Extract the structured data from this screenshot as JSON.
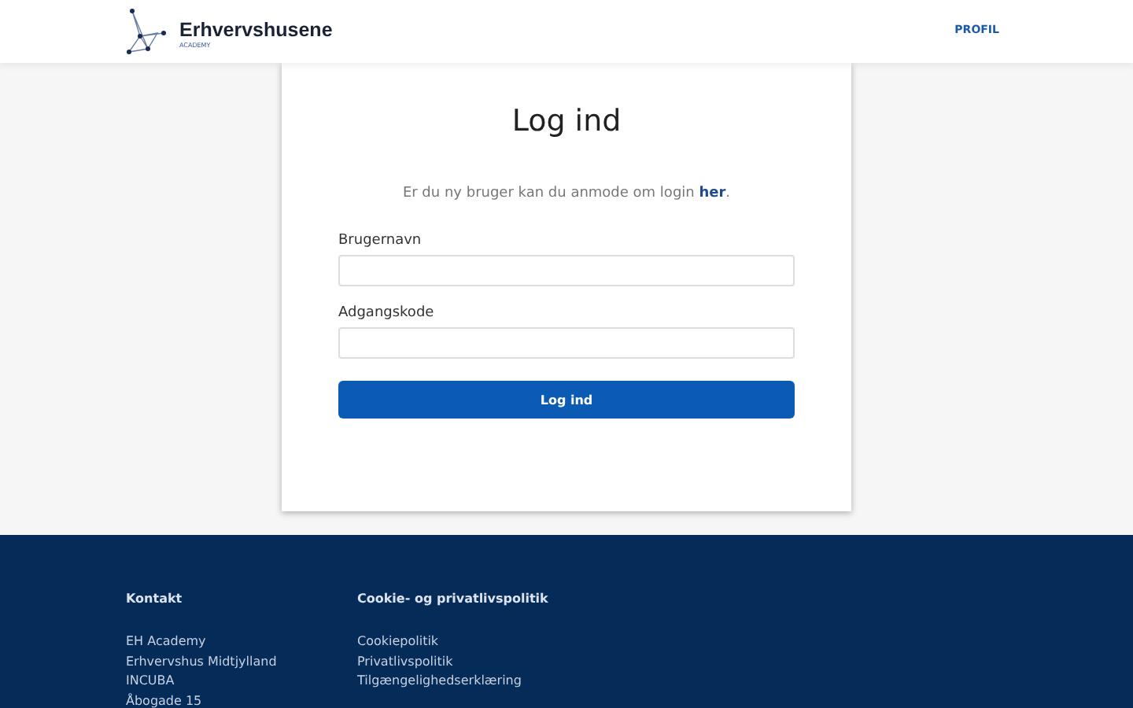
{
  "header": {
    "logo_name": "Erhvervshusene",
    "logo_sub": "ACADEMY",
    "nav": [
      "PROFIL"
    ]
  },
  "login": {
    "title": "Log ind",
    "intro": {
      "text": "Er du ny bruger kan du anmode om login ",
      "link": "her",
      "after": "."
    },
    "fields": [
      {
        "label": "Brugernavn"
      },
      {
        "label": "Adgangskode"
      }
    ],
    "button": "Log ind"
  },
  "footer": {
    "columns": [
      {
        "heading": "Kontakt",
        "items": [
          "EH Academy",
          "Erhvervshus Midtjylland",
          "INCUBA",
          "Åbogade 15"
        ]
      },
      {
        "heading": "Cookie- og privatlivspolitik",
        "items": [
          "Cookiepolitik",
          "Privatlivspolitik",
          "Tilgængelighedserklæring"
        ]
      }
    ]
  }
}
